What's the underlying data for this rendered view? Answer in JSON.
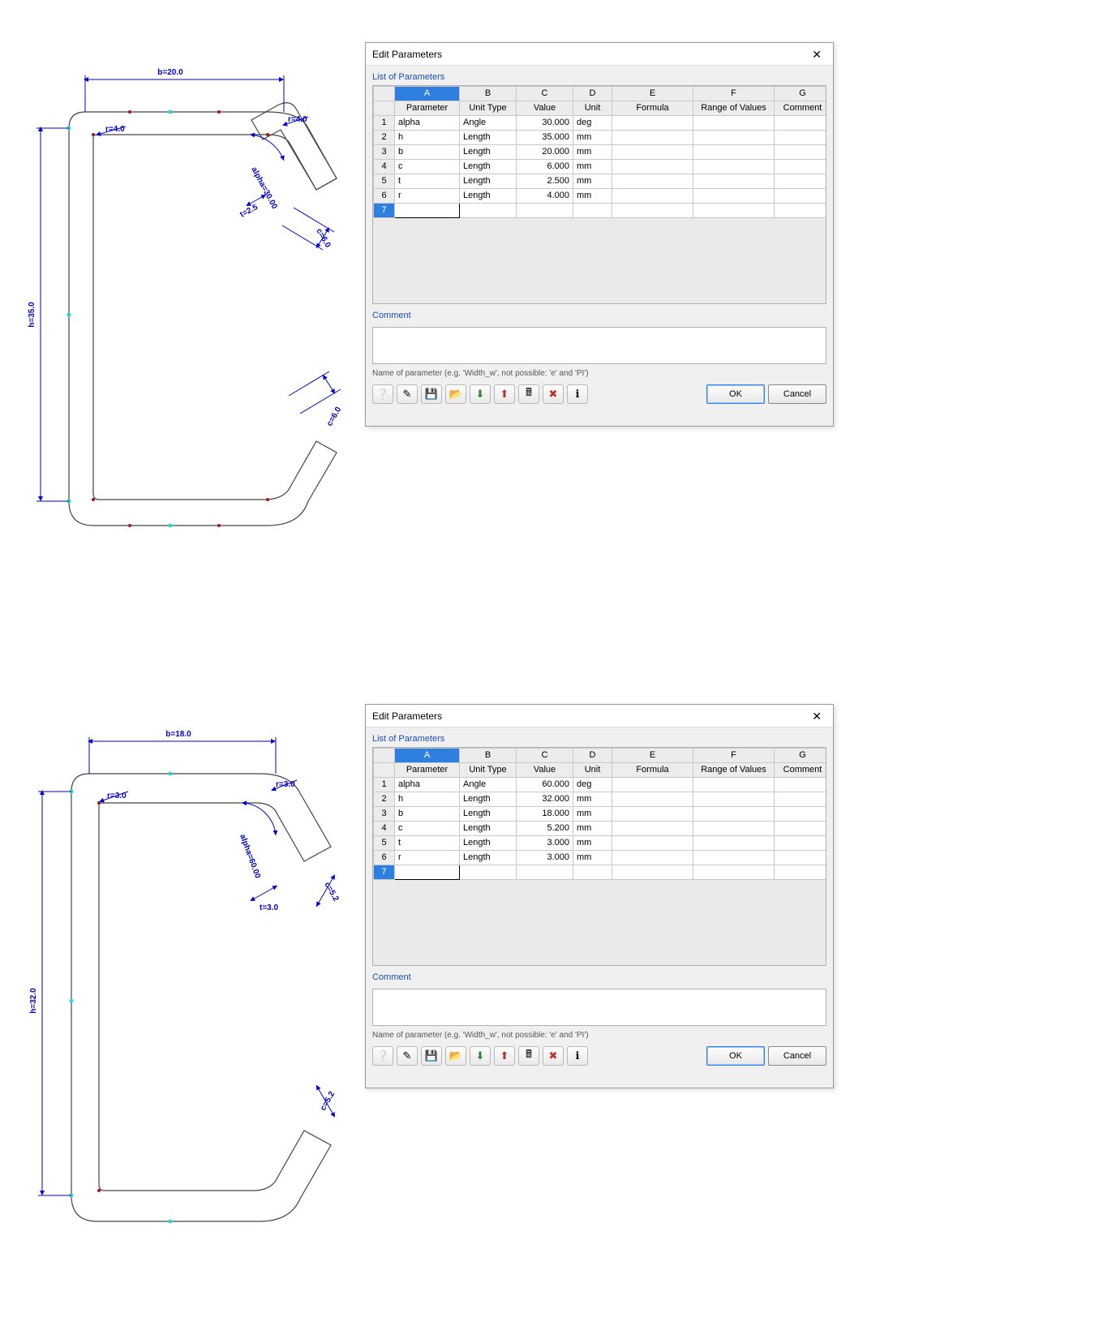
{
  "dialogs": [
    {
      "title": "Edit Parameters",
      "list_label": "List of Parameters",
      "columns_letters": [
        "A",
        "B",
        "C",
        "D",
        "E",
        "F",
        "G"
      ],
      "columns": [
        "Parameter",
        "Unit Type",
        "Value",
        "Unit",
        "Formula",
        "Range of Values",
        "Comment"
      ],
      "rows": [
        {
          "n": "1",
          "param": "alpha",
          "utype": "Angle",
          "value": "30.000",
          "unit": "deg",
          "formula": "",
          "range": "",
          "comment": ""
        },
        {
          "n": "2",
          "param": "h",
          "utype": "Length",
          "value": "35.000",
          "unit": "mm",
          "formula": "",
          "range": "",
          "comment": ""
        },
        {
          "n": "3",
          "param": "b",
          "utype": "Length",
          "value": "20.000",
          "unit": "mm",
          "formula": "",
          "range": "",
          "comment": ""
        },
        {
          "n": "4",
          "param": "c",
          "utype": "Length",
          "value": "6.000",
          "unit": "mm",
          "formula": "",
          "range": "",
          "comment": ""
        },
        {
          "n": "5",
          "param": "t",
          "utype": "Length",
          "value": "2.500",
          "unit": "mm",
          "formula": "",
          "range": "",
          "comment": ""
        },
        {
          "n": "6",
          "param": "r",
          "utype": "Length",
          "value": "4.000",
          "unit": "mm",
          "formula": "",
          "range": "",
          "comment": ""
        }
      ],
      "empty_row": "7",
      "comment_label": "Comment",
      "hint": "Name of parameter (e.g. 'Width_w', not possible: 'e' and 'PI')",
      "ok": "OK",
      "cancel": "Cancel"
    },
    {
      "title": "Edit Parameters",
      "list_label": "List of Parameters",
      "columns_letters": [
        "A",
        "B",
        "C",
        "D",
        "E",
        "F",
        "G"
      ],
      "columns": [
        "Parameter",
        "Unit Type",
        "Value",
        "Unit",
        "Formula",
        "Range of Values",
        "Comment"
      ],
      "rows": [
        {
          "n": "1",
          "param": "alpha",
          "utype": "Angle",
          "value": "60.000",
          "unit": "deg",
          "formula": "",
          "range": "",
          "comment": ""
        },
        {
          "n": "2",
          "param": "h",
          "utype": "Length",
          "value": "32.000",
          "unit": "mm",
          "formula": "",
          "range": "",
          "comment": ""
        },
        {
          "n": "3",
          "param": "b",
          "utype": "Length",
          "value": "18.000",
          "unit": "mm",
          "formula": "",
          "range": "",
          "comment": ""
        },
        {
          "n": "4",
          "param": "c",
          "utype": "Length",
          "value": "5.200",
          "unit": "mm",
          "formula": "",
          "range": "",
          "comment": ""
        },
        {
          "n": "5",
          "param": "t",
          "utype": "Length",
          "value": "3.000",
          "unit": "mm",
          "formula": "",
          "range": "",
          "comment": ""
        },
        {
          "n": "6",
          "param": "r",
          "utype": "Length",
          "value": "3.000",
          "unit": "mm",
          "formula": "",
          "range": "",
          "comment": ""
        }
      ],
      "empty_row": "7",
      "comment_label": "Comment",
      "hint": "Name of parameter (e.g. 'Width_w', not possible: 'e' and 'PI')",
      "ok": "OK",
      "cancel": "Cancel"
    }
  ],
  "drawings": [
    {
      "dims": {
        "b": "b=20.0",
        "h": "h=35.0",
        "r1": "r=4.0",
        "r2": "r=4.0",
        "alpha": "alpha=30.00",
        "t": "t=2.5",
        "c_top": "c=6.0",
        "c_bot": "c=6.0"
      }
    },
    {
      "dims": {
        "b": "b=18.0",
        "h": "h=32.0",
        "r1": "r=3.0",
        "r2": "r=3.0",
        "alpha": "alpha=60.00",
        "t": "t=3.0",
        "c_top": "c=5.2",
        "c_bot": "c=5.2"
      }
    }
  ],
  "toolbar_icons": [
    "help",
    "edit",
    "save",
    "open",
    "excel-import",
    "excel-export",
    "calc",
    "delete",
    "info"
  ]
}
